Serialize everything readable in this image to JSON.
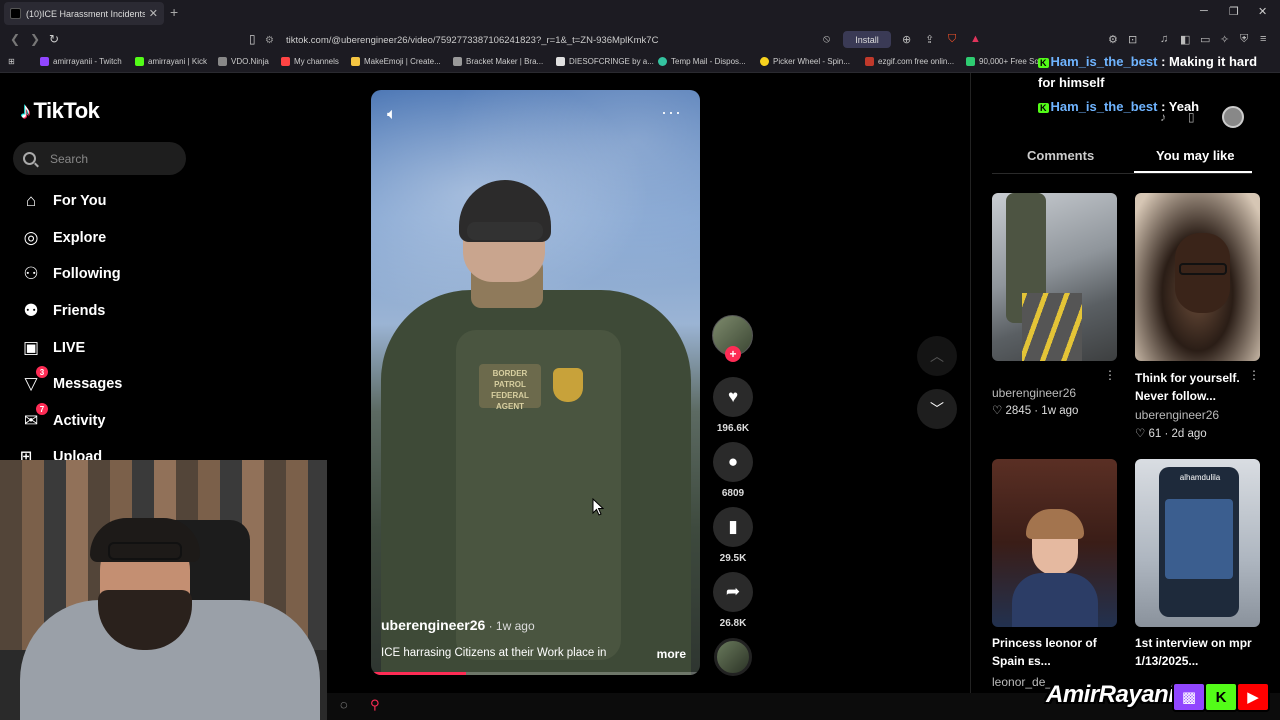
{
  "browser": {
    "tab_title": "(10)ICE Harassment Incidents in",
    "tab_close": "✕",
    "new_tab": "+",
    "url": "tiktok.com/@uberengineer26/video/7592773387106241823?_r=1&_t=ZN-936MplKmk7C",
    "install_label": "Install",
    "bookmarks": [
      {
        "label": "amirrayanii - Twitch",
        "color": "#9146ff"
      },
      {
        "label": "amirrayani | Kick",
        "color": "#53fc18"
      },
      {
        "label": "VDO.Ninja",
        "color": "#888888"
      },
      {
        "label": "My channels",
        "color": "#ff4444"
      },
      {
        "label": "MakeEmoji | Create...",
        "color": "#f5c542"
      },
      {
        "label": "Bracket Maker | Bra...",
        "color": "#999999"
      },
      {
        "label": "DIESOFCRINGE by a...",
        "color": "#e0e0e0"
      },
      {
        "label": "Temp Mail - Dispos...",
        "color": "#34c3a0"
      },
      {
        "label": "Picker Wheel - Spin...",
        "color": "#f7d21e"
      },
      {
        "label": "ezgif.com free onlin...",
        "color": "#c0392b"
      },
      {
        "label": "90,000+ Free So",
        "color": "#2ecc71"
      }
    ]
  },
  "tiktok": {
    "logo": "TikTok",
    "search_placeholder": "Search",
    "nav": [
      {
        "label": "For You",
        "icon": "home-icon",
        "glyph": "⌂"
      },
      {
        "label": "Explore",
        "icon": "compass-icon",
        "glyph": "◎"
      },
      {
        "label": "Following",
        "icon": "following-icon",
        "glyph": "⚇"
      },
      {
        "label": "Friends",
        "icon": "friends-icon",
        "glyph": "⚉"
      },
      {
        "label": "LIVE",
        "icon": "live-icon",
        "glyph": "▣"
      },
      {
        "label": "Messages",
        "icon": "messages-icon",
        "glyph": "▽",
        "badge": "3"
      },
      {
        "label": "Activity",
        "icon": "activity-icon",
        "glyph": "✉",
        "badge": "7"
      }
    ],
    "upload_label": "Upload"
  },
  "video": {
    "author": "uberengineer26",
    "ago": " · 1w ago",
    "caption": "ICE harrasing Citizens at their Work place in",
    "more": "more",
    "patch_text": "BORDER PATROL FEDERAL AGENT",
    "progress": 0.29,
    "likes": "196.6K",
    "comments": "6809",
    "saves": "29.5K",
    "shares": "26.8K"
  },
  "panel": {
    "tab_comments": "Comments",
    "tab_you_may_like": "You may like",
    "cards": [
      {
        "title": "",
        "user": "uberengineer26",
        "meta": "♡ 2845 · 1w ago"
      },
      {
        "title": "Think for yourself. Never follow...",
        "user": "uberengineer26",
        "meta": "♡ 61 · 2d ago"
      },
      {
        "title": "Princess leonor of Spain ᴇs...",
        "user": "leonor_de_",
        "meta": ""
      },
      {
        "title": "1st interview on mpr 1/13/2025...",
        "user": "",
        "meta": ""
      }
    ],
    "thumb_text_2": "alhamdulila"
  },
  "chat": [
    {
      "user": "Ham_is_the_best",
      "message": " : Making it hard",
      "continued": "for himself"
    },
    {
      "user": "Ham_is_the_best",
      "message": " : Yeah"
    }
  ],
  "stream": {
    "name": "AmirRayani",
    "colors": {
      "twitch": "#9146ff",
      "kick": "#53fc18",
      "youtube": "#ff0000"
    }
  }
}
